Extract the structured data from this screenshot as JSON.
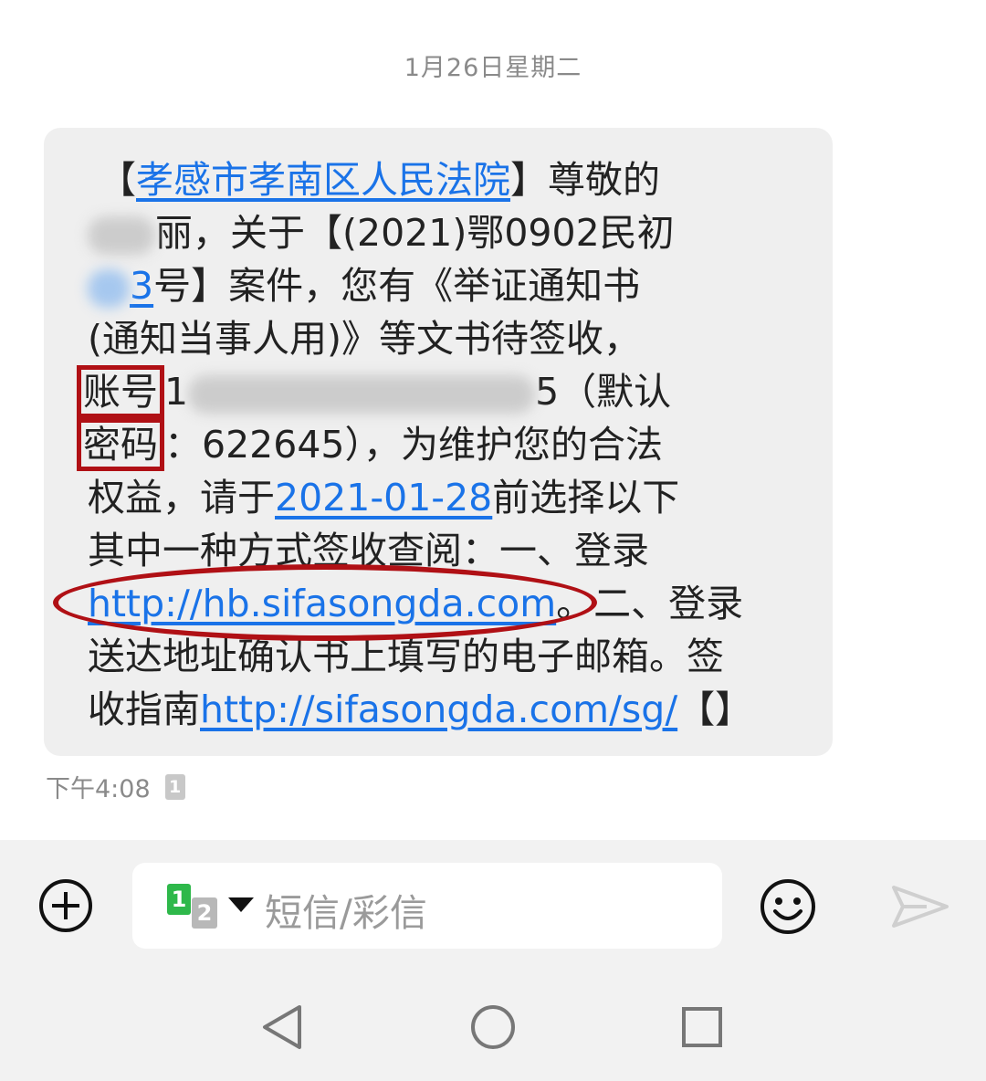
{
  "header": {
    "date": "1月26日星期二"
  },
  "message": {
    "court_name": "孝感市孝南区人民法院",
    "lines": [
      [
        "【",
        "孝感市孝南区人民法院",
        "】尊敬的"
      ],
      [
        "",
        "丽，关于【(2021)鄂0902民初"
      ],
      [
        "",
        "3",
        "号】案件，您有《举证通知书"
      ],
      [
        "(通知当事人用)》等文书待签收，"
      ],
      [
        "账号",
        "1",
        "5（默认"
      ],
      [
        "密码",
        "：622645），为维护您的合法"
      ],
      [
        "权益，请于",
        "2021-01-28",
        "前选择以下"
      ],
      [
        "其中一种方式签收查阅：一、登录"
      ],
      [
        "http://hb.sifasongda.com",
        "。二、登录"
      ],
      [
        "送达地址确认书上填写的电子邮箱。签"
      ],
      [
        "收指南",
        "http://sifasongda.com/sg/",
        "【】"
      ]
    ]
  },
  "meta": {
    "time": "下午4:08",
    "sim_badge": "1"
  },
  "composer": {
    "sim_primary": "1",
    "sim_secondary": "2",
    "placeholder": "短信/彩信"
  },
  "icons": {
    "add": "plus-circle-icon",
    "emoji": "smiley-icon",
    "send": "send-arrow-icon",
    "back": "nav-back-icon",
    "home": "nav-home-icon",
    "recent": "nav-recent-icon"
  },
  "colors": {
    "link": "#1a73e8",
    "annotation": "#b01015",
    "bubble": "#efefef",
    "sim_green": "#2eb84a"
  }
}
